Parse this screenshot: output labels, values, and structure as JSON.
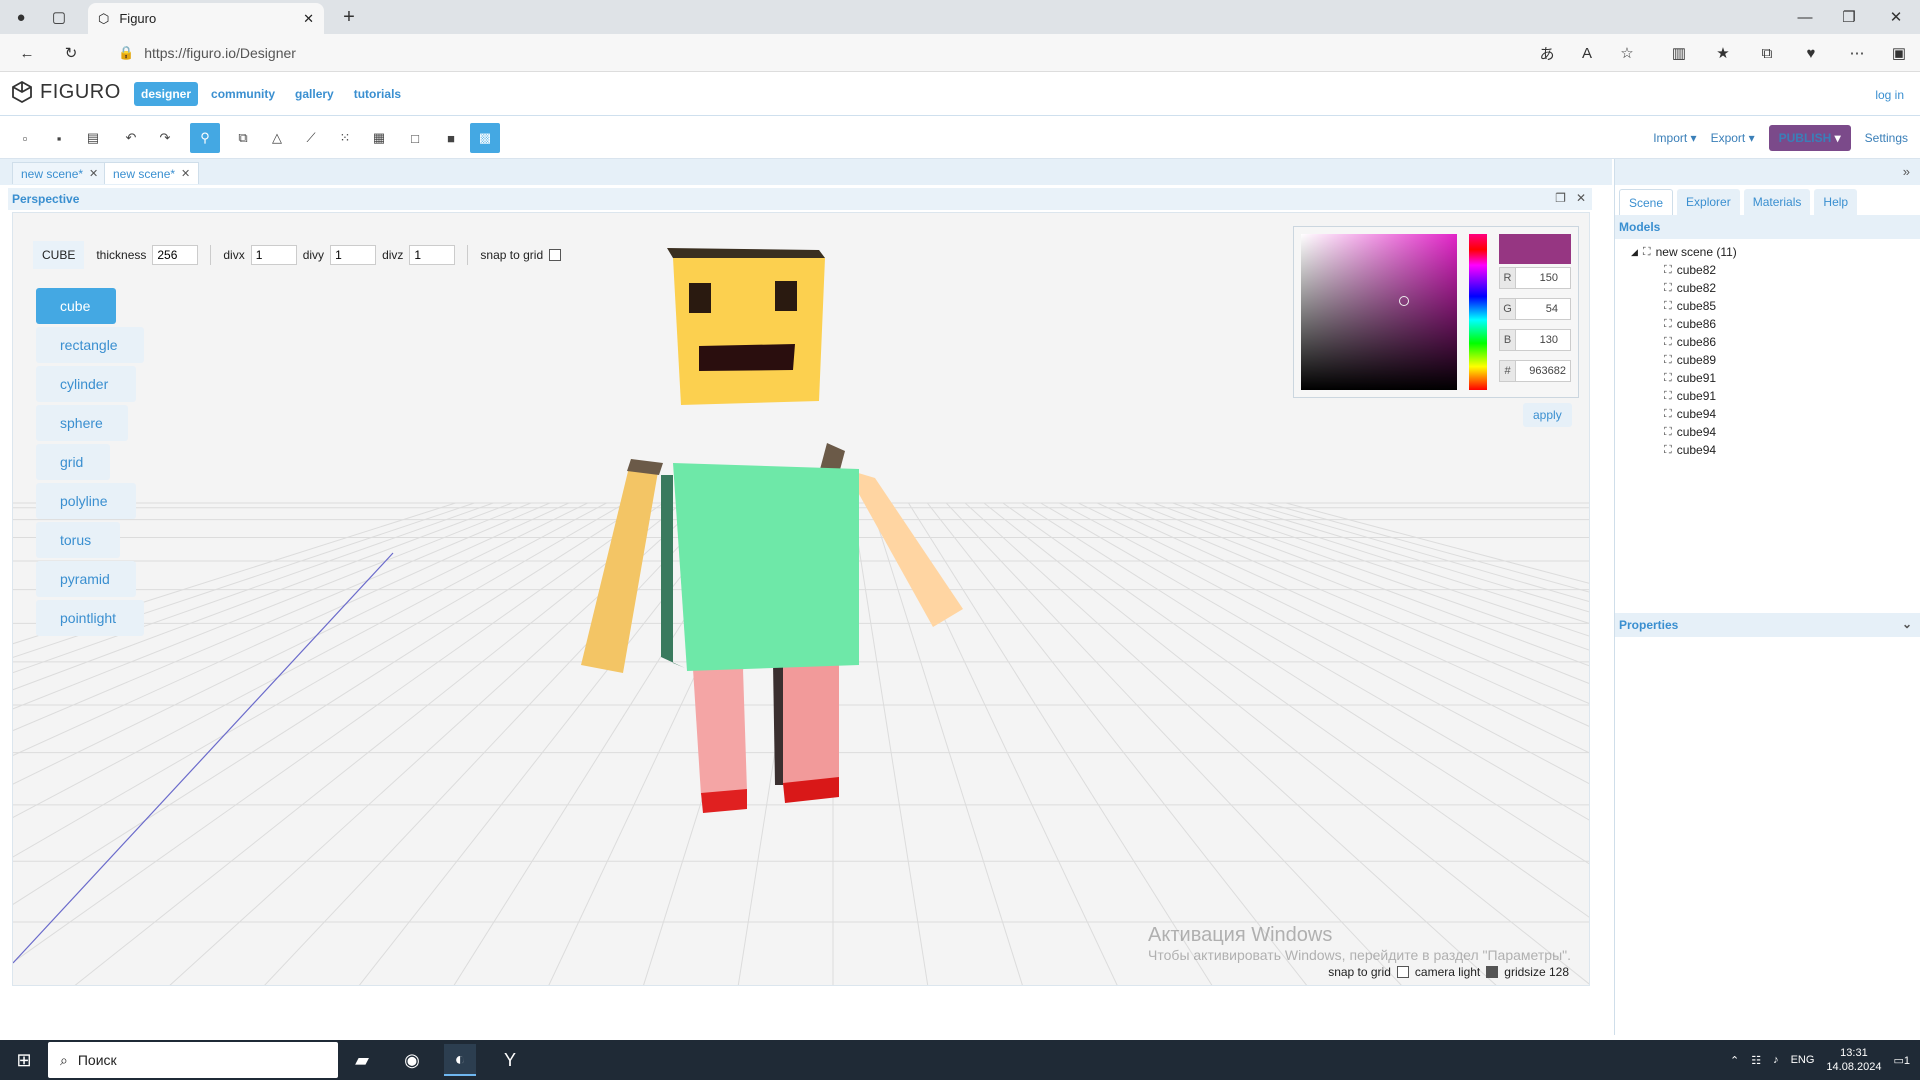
{
  "browser": {
    "tab_title": "Figuro",
    "url": "https://figuro.io/Designer"
  },
  "app": {
    "logo_text": "FIGURO",
    "nav": [
      {
        "label": "designer",
        "active": true
      },
      {
        "label": "community",
        "active": false
      },
      {
        "label": "gallery",
        "active": false
      },
      {
        "label": "tutorials",
        "active": false
      }
    ],
    "login": "log in"
  },
  "toolbar": {
    "import": "Import",
    "export": "Export",
    "publish": "PUBLISH",
    "settings": "Settings"
  },
  "doc_tabs": [
    {
      "label": "new scene*"
    },
    {
      "label": "new scene*"
    }
  ],
  "viewport": {
    "title": "Perspective",
    "shape_name": "CUBE",
    "thickness_label": "thickness",
    "thickness_value": "256",
    "divx_label": "divx",
    "divx_value": "1",
    "divy_label": "divy",
    "divy_value": "1",
    "divz_label": "divz",
    "divz_value": "1",
    "snap_label": "snap to grid",
    "shapes": [
      {
        "label": "cube",
        "active": true
      },
      {
        "label": "rectangle",
        "active": false
      },
      {
        "label": "cylinder",
        "active": false
      },
      {
        "label": "sphere",
        "active": false
      },
      {
        "label": "grid",
        "active": false
      },
      {
        "label": "polyline",
        "active": false
      },
      {
        "label": "torus",
        "active": false
      },
      {
        "label": "pyramid",
        "active": false
      },
      {
        "label": "pointlight",
        "active": false
      }
    ],
    "footer": {
      "snap_label": "snap to grid",
      "camera_light_label": "camera light",
      "camera_light_checked": true,
      "gridsize_label": "gridsize 128"
    },
    "watermark_line1": "Активация Windows",
    "watermark_line2": "Чтобы активировать Windows, перейдите в раздел \"Параметры\"."
  },
  "color_picker": {
    "r_label": "R",
    "r": "150",
    "g_label": "G",
    "g": "54",
    "b_label": "B",
    "b": "130",
    "hex_label": "#",
    "hex": "963682",
    "swatch": "#963682",
    "apply": "apply"
  },
  "right_panel": {
    "tabs": [
      {
        "label": "Scene",
        "active": true
      },
      {
        "label": "Explorer",
        "active": false
      },
      {
        "label": "Materials",
        "active": false
      },
      {
        "label": "Help",
        "active": false
      }
    ],
    "models_title": "Models",
    "root": "new scene (11)",
    "items": [
      "cube82",
      "cube82",
      "cube85",
      "cube86",
      "cube86",
      "cube89",
      "cube91",
      "cube91",
      "cube94",
      "cube94",
      "cube94"
    ],
    "properties_title": "Properties"
  },
  "taskbar": {
    "search_placeholder": "Поиск",
    "lang": "ENG",
    "time": "13:31",
    "date": "14.08.2024",
    "notifications": "1"
  },
  "colors": {
    "accent": "#44a8e3",
    "publish": "#7b4a8a",
    "head": "#fcd04f",
    "body": "#6ee8a8",
    "arm": "#ffd27a",
    "leg": "#f29a9a",
    "shoe": "#e02020"
  }
}
